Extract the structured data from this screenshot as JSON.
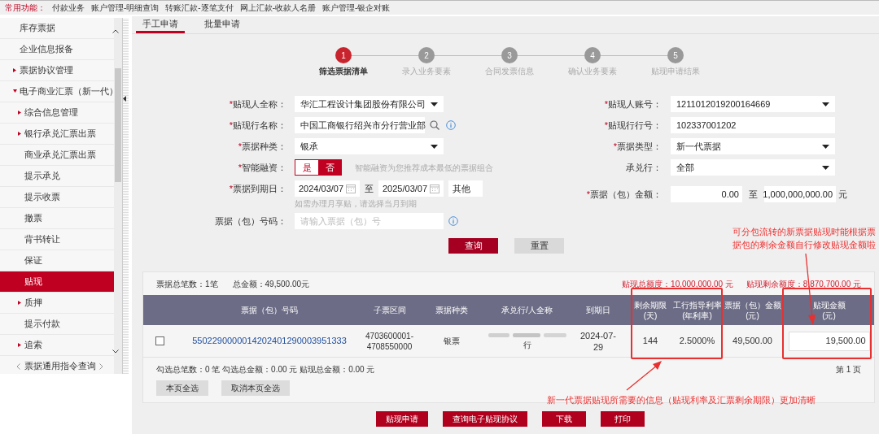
{
  "top_bar": {
    "label": "常用功能：",
    "links": [
      "付款业务",
      "账户管理-明细查询",
      "转账汇款-逐笔支付",
      "网上汇款-收款人名册",
      "账户管理-银企对账"
    ]
  },
  "sidebar": {
    "items": [
      {
        "label": "库存票据",
        "selected": false
      },
      {
        "label": "企业信息报备",
        "selected": false
      },
      {
        "label": "票据协议管理",
        "selected": false,
        "expanded": false
      },
      {
        "label": "电子商业汇票（新一代）",
        "selected": false,
        "expanded": true,
        "children": [
          {
            "label": "综合信息管理",
            "selected": false,
            "expanded": false
          },
          {
            "label": "银行承兑汇票出票",
            "selected": false,
            "expanded": false
          },
          {
            "label": "商业承兑汇票出票",
            "selected": false
          },
          {
            "label": "提示承兑",
            "selected": false
          },
          {
            "label": "提示收票",
            "selected": false
          },
          {
            "label": "撤票",
            "selected": false
          },
          {
            "label": "背书转让",
            "selected": false
          },
          {
            "label": "保证",
            "selected": false
          },
          {
            "label": "贴现",
            "selected": true
          },
          {
            "label": "质押",
            "selected": false,
            "expanded": false
          },
          {
            "label": "提示付款",
            "selected": false
          },
          {
            "label": "追索",
            "selected": false,
            "expanded": false
          },
          {
            "label": "票据通用指令查询",
            "selected": false
          }
        ]
      }
    ]
  },
  "tabs": [
    {
      "label": "手工申请",
      "selected": true
    },
    {
      "label": "批量申请",
      "selected": false
    }
  ],
  "steps": [
    {
      "number": "1",
      "label": "筛选票据清单",
      "selected": true
    },
    {
      "number": "2",
      "label": "录入业务要素",
      "selected": false
    },
    {
      "number": "3",
      "label": "合同发票信息",
      "selected": false
    },
    {
      "number": "4",
      "label": "确认业务要素",
      "selected": false
    },
    {
      "number": "5",
      "label": "贴现申请结果",
      "selected": false
    }
  ],
  "form": {
    "left": [
      {
        "kind": "select",
        "mark": "*",
        "label": "贴现人全称：",
        "value": "华汇工程设计集团股份有限公司"
      },
      {
        "kind": "search",
        "mark": "*",
        "label": "贴现行名称：",
        "value": "中国工商银行绍兴市分行营业部"
      },
      {
        "kind": "select",
        "mark": "*",
        "label": "票据种类：",
        "value": "银承"
      },
      {
        "kind": "toggle",
        "mark": "*",
        "label": "智能融资：",
        "options": [
          {
            "label": "是",
            "selected": false
          },
          {
            "label": "否",
            "selected": true
          }
        ],
        "hint": "智能融资为您推荐成本最低的票据组合"
      },
      {
        "kind": "date_range",
        "mark": "*",
        "label": "票据到期日：",
        "from": "2024/03/07",
        "separator": "至",
        "to": "2025/03/07",
        "extra": "其他",
        "hint": "如需办理月享贴，请选择当月到期"
      },
      {
        "kind": "input",
        "label": "票据（包）号码：",
        "placeholder": "请输入票据（包）号"
      }
    ],
    "right": [
      {
        "kind": "select",
        "mark": "*",
        "label": "贴现人账号：",
        "value": "1211012019200164669"
      },
      {
        "kind": "input",
        "mark": "*",
        "label": "贴现行行号：",
        "value": "102337001202"
      },
      {
        "kind": "select",
        "mark": "*",
        "label": "票据类型：",
        "value": "新一代票据"
      },
      {
        "kind": "select",
        "label": "承兑行：",
        "value": "全部"
      },
      {
        "kind": "amount_range",
        "mark": "*",
        "label": "票据（包）金额：",
        "from": "0.00",
        "separator": "至",
        "to": "1,000,000,000.00",
        "unit": "元"
      }
    ],
    "buttons": [
      {
        "label": "查询",
        "kind": "primary"
      },
      {
        "label": "重置",
        "kind": "secondary"
      }
    ]
  },
  "results": {
    "count": "票据总笔数：1笔",
    "total": "总金额：49,500.00元",
    "quota": "贴现总额度：10,000,000.00 元",
    "remaining": "贴现剩余额度：8,870,700.00 元",
    "columns": [
      [
        "票据（包）号码"
      ],
      [
        "子票区间"
      ],
      [
        "票据种类"
      ],
      [
        "承兑行/人全称"
      ],
      [
        "到期日"
      ],
      [
        "剩余期限",
        "(天)"
      ],
      [
        "工行指导利率",
        "(年利率)"
      ],
      [
        "票据（包）金额",
        "(元)"
      ],
      [
        "贴现金额",
        "(元)"
      ]
    ],
    "rows": [
      {
        "checked": false,
        "number": "5502290000014202401290003951333",
        "range": "4703600001-4708550000",
        "type": "银票",
        "acceptor": "行",
        "due": "2024-07-29",
        "days": "144",
        "rate": "2.5000%",
        "amount": "49,500.00",
        "discount": "19,500.00"
      }
    ],
    "selection": "勾选总笔数：0 笔 勾选总金额：0.00 元 贴现总金额：0.00 元",
    "page": "第 1 页",
    "buttons": [
      "本页全选",
      "取消本页全选"
    ]
  },
  "actions": [
    "贴现申请",
    "查询电子贴现协议",
    "下载",
    "打印"
  ],
  "annotations": [
    "可分包流转的新票据贴现时能根据票据包的剩余金额自行修改贴现金额啦",
    "新一代票据贴现所需要的信息（贴现利率及汇票剩余期限）更加清晰"
  ]
}
